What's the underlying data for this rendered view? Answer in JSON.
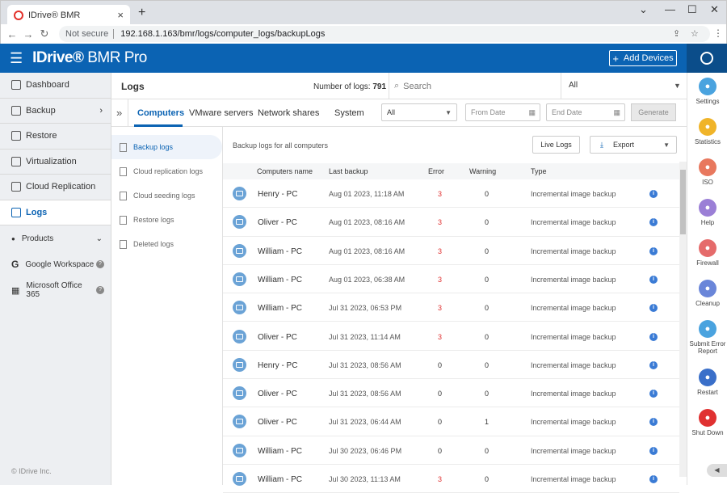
{
  "browser": {
    "tab_title": "IDrive® BMR",
    "not_secure": "Not secure",
    "url": "192.168.1.163/bmr/logs/computer_logs/backupLogs"
  },
  "header": {
    "brand_bold": "IDrive®",
    "brand_light": "BMR Pro",
    "add_devices": "Add Devices"
  },
  "sidebar": {
    "items": [
      {
        "label": "Dashboard",
        "icon": "dashboard-icon"
      },
      {
        "label": "Backup",
        "icon": "backup-icon"
      },
      {
        "label": "Restore",
        "icon": "restore-icon"
      },
      {
        "label": "Virtualization",
        "icon": "virtualization-icon"
      },
      {
        "label": "Cloud Replication",
        "icon": "cloud-icon"
      },
      {
        "label": "Logs",
        "icon": "logs-icon"
      }
    ],
    "products": "Products",
    "google_workspace": "Google Workspace",
    "office365": "Microsoft Office 365",
    "copyright": "© IDrive Inc."
  },
  "logs_header": {
    "title": "Logs",
    "num_label": "Number of logs:",
    "num_value": "791",
    "search_placeholder": "Search",
    "filter_value": "All"
  },
  "tabs": [
    "Computers",
    "VMware servers",
    "Network shares",
    "System"
  ],
  "filters": {
    "type_value": "All",
    "from_date": "From Date",
    "end_date": "End Date",
    "generate": "Generate"
  },
  "subnav": [
    "Backup logs",
    "Cloud replication logs",
    "Cloud seeding logs",
    "Restore logs",
    "Deleted logs"
  ],
  "content": {
    "label": "Backup logs for all computers",
    "live_logs": "Live Logs",
    "export": "Export"
  },
  "table": {
    "columns": [
      "Computers name",
      "Last backup",
      "Error",
      "Warning",
      "Type"
    ],
    "rows": [
      {
        "name": "Henry - PC",
        "last": "Aug 01 2023, 11:18 AM",
        "error": "3",
        "warning": "0",
        "type": "Incremental image backup"
      },
      {
        "name": "Oliver - PC",
        "last": "Aug 01 2023, 08:16 AM",
        "error": "3",
        "warning": "0",
        "type": "Incremental image backup"
      },
      {
        "name": "William - PC",
        "last": "Aug 01 2023, 08:16 AM",
        "error": "3",
        "warning": "0",
        "type": "Incremental image backup"
      },
      {
        "name": "William - PC",
        "last": "Aug 01 2023, 06:38 AM",
        "error": "3",
        "warning": "0",
        "type": "Incremental image backup"
      },
      {
        "name": "William - PC",
        "last": "Jul 31 2023, 06:53 PM",
        "error": "3",
        "warning": "0",
        "type": "Incremental image backup"
      },
      {
        "name": "Oliver - PC",
        "last": "Jul 31 2023, 11:14 AM",
        "error": "3",
        "warning": "0",
        "type": "Incremental image backup"
      },
      {
        "name": "Henry - PC",
        "last": "Jul 31 2023, 08:56 AM",
        "error": "0",
        "warning": "0",
        "type": "Incremental image backup"
      },
      {
        "name": "Oliver - PC",
        "last": "Jul 31 2023, 08:56 AM",
        "error": "0",
        "warning": "0",
        "type": "Incremental image backup"
      },
      {
        "name": "Oliver - PC",
        "last": "Jul 31 2023, 06:44 AM",
        "error": "0",
        "warning": "1",
        "type": "Incremental image backup"
      },
      {
        "name": "William - PC",
        "last": "Jul 30 2023, 06:46 PM",
        "error": "0",
        "warning": "0",
        "type": "Incremental image backup"
      },
      {
        "name": "William - PC",
        "last": "Jul 30 2023, 11:13 AM",
        "error": "3",
        "warning": "0",
        "type": "Incremental image backup"
      }
    ]
  },
  "rightbar": [
    {
      "label": "Settings",
      "color": "#4aa3df",
      "icon": "gear-icon"
    },
    {
      "label": "Statistics",
      "color": "#f0b429",
      "icon": "chart-icon"
    },
    {
      "label": "ISO",
      "color": "#e8785e",
      "icon": "iso-icon"
    },
    {
      "label": "Help",
      "color": "#9b7fd6",
      "icon": "help-icon"
    },
    {
      "label": "Firewall",
      "color": "#e56b6b",
      "icon": "firewall-icon"
    },
    {
      "label": "Cleanup",
      "color": "#6a86d9",
      "icon": "cleanup-icon"
    },
    {
      "label": "Submit Error Report",
      "color": "#4aa3df",
      "icon": "warning-icon"
    },
    {
      "label": "Restart",
      "color": "#3a6fc9",
      "icon": "restart-icon"
    },
    {
      "label": "Shut Down",
      "color": "#e03131",
      "icon": "power-icon"
    }
  ],
  "colors": {
    "accent": "#0b63b3",
    "error": "#e03131"
  }
}
